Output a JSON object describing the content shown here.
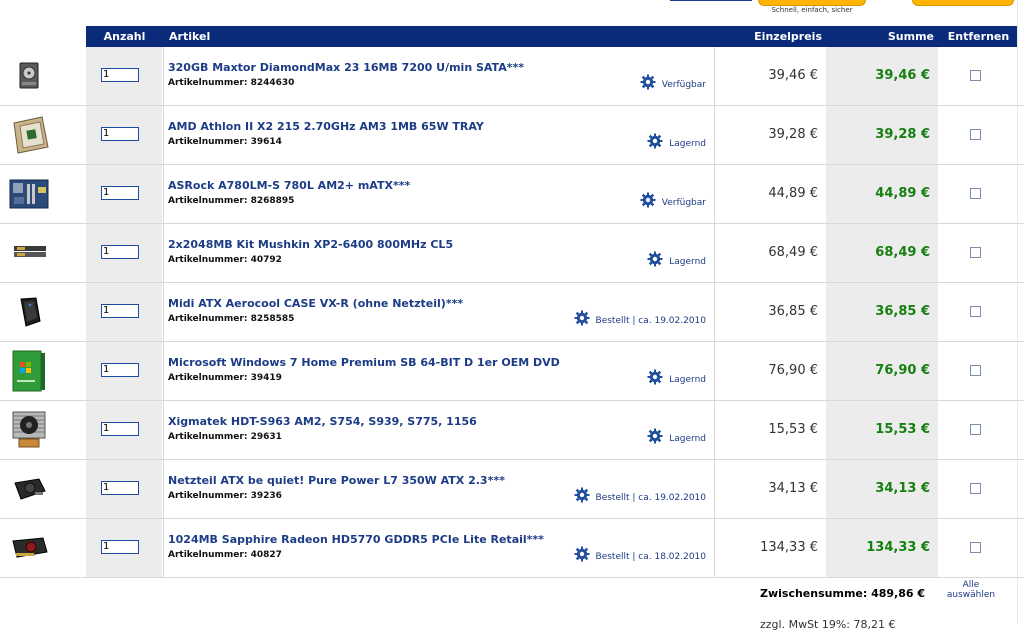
{
  "header": {
    "tagline": "Schnell, einfach, sicher"
  },
  "columns": {
    "anzahl": "Anzahl",
    "artikel": "Artikel",
    "einzelpreis": "Einzelpreis",
    "summe": "Summe",
    "entfernen": "Entfernen"
  },
  "items": [
    {
      "qty": "1",
      "name": "320GB Maxtor DiamondMax 23 16MB 7200 U/min SATA***",
      "number": "Artikelnummer: 8244630",
      "status": "Verfügbar",
      "price": "39,46 €",
      "total": "39,46 €",
      "image": "hdd-image"
    },
    {
      "qty": "1",
      "name": "AMD Athlon II X2 215 2.70GHz AM3 1MB 65W TRAY",
      "number": "Artikelnummer: 39614",
      "status": "Lagernd",
      "price": "39,28 €",
      "total": "39,28 €",
      "image": "cpu-image"
    },
    {
      "qty": "1",
      "name": "ASRock A780LM-S 780L AM2+ mATX***",
      "number": "Artikelnummer: 8268895",
      "status": "Verfügbar",
      "price": "44,89 €",
      "total": "44,89 €",
      "image": "motherboard-image"
    },
    {
      "qty": "1",
      "name": "2x2048MB Kit Mushkin XP2-6400 800MHz CL5",
      "number": "Artikelnummer: 40792",
      "status": "Lagernd",
      "price": "68,49 €",
      "total": "68,49 €",
      "image": "ram-image"
    },
    {
      "qty": "1",
      "name": "Midi ATX Aerocool CASE VX-R (ohne Netzteil)***",
      "number": "Artikelnummer: 8258585",
      "status": "Bestellt | ca. 19.02.2010",
      "price": "36,85 €",
      "total": "36,85 €",
      "image": "case-image"
    },
    {
      "qty": "1",
      "name": "Microsoft Windows 7 Home Premium SB 64-BIT D 1er OEM DVD",
      "number": "Artikelnummer: 39419",
      "status": "Lagernd",
      "price": "76,90 €",
      "total": "76,90 €",
      "image": "windows-box-image"
    },
    {
      "qty": "1",
      "name": "Xigmatek HDT-S963 AM2, S754, S939, S775, 1156",
      "number": "Artikelnummer: 29631",
      "status": "Lagernd",
      "price": "15,53 €",
      "total": "15,53 €",
      "image": "cooler-image"
    },
    {
      "qty": "1",
      "name": "Netzteil ATX be quiet! Pure Power L7 350W ATX 2.3***",
      "number": "Artikelnummer: 39236",
      "status": "Bestellt | ca. 19.02.2010",
      "price": "34,13 €",
      "total": "34,13 €",
      "image": "psu-image"
    },
    {
      "qty": "1",
      "name": "1024MB Sapphire Radeon HD5770 GDDR5 PCIe Lite Retail***",
      "number": "Artikelnummer: 40827",
      "status": "Bestellt | ca. 18.02.2010",
      "price": "134,33 €",
      "total": "134,33 €",
      "image": "gpu-image"
    }
  ],
  "footer": {
    "subtotal": "Zwischensumme: 489,86 €",
    "select_all_line1": "Alle",
    "select_all_line2": "auswählen",
    "cut_line": "zzgl. MwSt 19%: 78,21 €"
  },
  "colors": {
    "header_bg": "#0a2a7a",
    "sum_green": "#15800f",
    "link_blue": "#1d3c86",
    "cell_gray": "#ececec"
  }
}
